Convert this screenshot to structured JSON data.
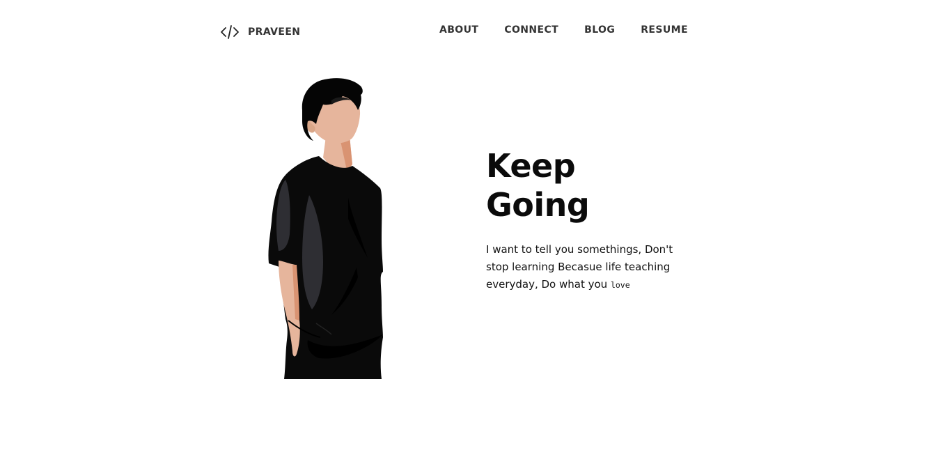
{
  "header": {
    "logo_text": "PRAVEEN",
    "logo_icon": "code-brackets-icon",
    "nav": [
      {
        "label": "ABOUT"
      },
      {
        "label": "CONNECT"
      },
      {
        "label": "BLOG"
      },
      {
        "label": "RESUME"
      }
    ]
  },
  "hero": {
    "title": "Keep Going",
    "text_main": "I want to tell you somethings, Don't stop learning Becasue life teaching everyday, Do what you ",
    "text_mono": "love",
    "illustration": "person-in-black-tshirt-illustration"
  },
  "colors": {
    "background": "#ffffff",
    "text": "#111111",
    "nav_text": "#333333",
    "skin": "#e6b59c",
    "shirt": "#0a0a0a",
    "shirt_highlight": "#2e2e33",
    "hair": "#050505"
  }
}
